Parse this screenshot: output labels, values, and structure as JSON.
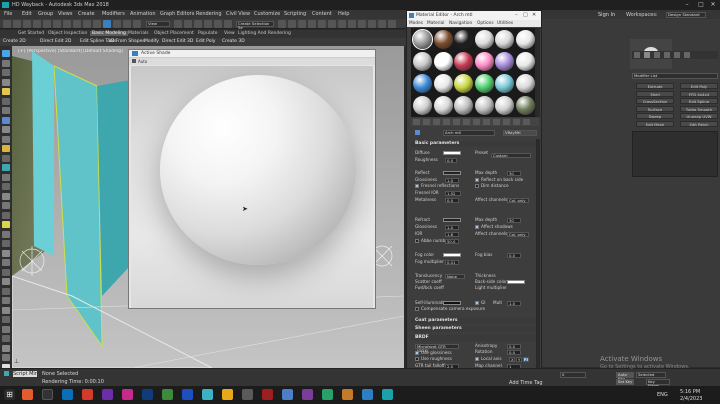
{
  "window": {
    "title": "HD Wayback - Autodesk 3ds Max 2018"
  },
  "menubar": {
    "items": [
      "File",
      "Edit",
      "Group",
      "Views",
      "Create",
      "Modifiers",
      "Animation",
      "Graph Editors",
      "Rendering",
      "Civil View",
      "Customize",
      "Scripting",
      "Content",
      "Help"
    ],
    "sign_in": "Sign In",
    "workspaces_label": "Workspaces:",
    "workspace_value": "Design Standard"
  },
  "toolbar": {
    "view_dropdown": "View",
    "selection_set": "Create Selection Se"
  },
  "ribbon": {
    "tabs": [
      "Get Started",
      "Object Inspection",
      "Basic Modeling",
      "Materials",
      "Object Placement",
      "Populate",
      "View",
      "Lighting And Rendering"
    ],
    "selected_tab": "Basic Modeling",
    "subtabs": [
      "Create 2D",
      "Direct Edit 2D",
      "Edit Spline Tools",
      "3D From Shapes",
      "Modify",
      "Direct Edit 3D",
      "Edit Poly",
      "Create 3D"
    ]
  },
  "viewport": {
    "label": "[+] [Perspective] [Standard] [Default Shading]"
  },
  "active_shade": {
    "title": "Active Shade",
    "toolbar_label": "Auto"
  },
  "material_editor": {
    "title": "Material Editor - Arch mtl",
    "menu": [
      "Modes",
      "Material",
      "Navigation",
      "Options",
      "Utilities"
    ],
    "material_name": "Arch mtl",
    "material_type": "VRayMtl",
    "sections": {
      "basic": "Basic parameters",
      "coat": "Coat parameters",
      "sheen": "Sheen parameters",
      "brdf": "BRDF",
      "options": "Options"
    },
    "basic_params": {
      "diffuse": "Diffuse",
      "roughness": "Roughness",
      "roughness_val": "0.0",
      "preset": "Preset",
      "preset_val": "Custom",
      "reflect": "Reflect",
      "max_depth": "Max depth",
      "max_depth_val": "30",
      "glossiness": "Glossiness",
      "glossiness_val": "1.0",
      "reflect_back": "Reflect on back side",
      "fresnel": "Fresnel reflections",
      "dim_distance": "Dim distance",
      "fresnel_ior": "Fresnel IOR",
      "fresnel_ior_val": "1.52",
      "metalness": "Metalness",
      "metalness_val": "0.0",
      "affect_channels": "Affect channels",
      "affect_channels_val": "Col. only",
      "refract": "Refract",
      "refract_max_depth": "Max depth",
      "refract_max_depth_val": "30",
      "refract_gloss": "Glossiness",
      "refract_gloss_val": "1.0",
      "affect_shadows": "Affect shadows",
      "ior": "IOR",
      "ior_val": "1.6",
      "refract_affect": "Affect channels",
      "refract_affect_val": "Col. only",
      "abbe": "Abbe number",
      "abbe_val": "50.0",
      "fog_color": "Fog color",
      "fog_bias": "Fog bias",
      "fog_bias_val": "0.0",
      "fog_mult": "Fog multiplier",
      "fog_mult_val": "0.01",
      "translucency": "Translucency",
      "translucency_val": "None",
      "thickness": "Thickness",
      "scatter_coeff": "Scatter coeff",
      "back_side_color": "Back-side color",
      "fwd_bck_coeff": "Fwd/bck coeff",
      "light_multiplier": "Light multiplier",
      "self_illumination": "Self-illumination",
      "gi": "GI",
      "mult": "Mult",
      "mult_val": "1.0",
      "compensate": "Compensate camera exposure"
    },
    "brdf_params": {
      "type": "Microfacet GTR (GGX)",
      "anisotropy": "Anisotropy",
      "anisotropy_val": "0.0",
      "rotation": "Rotation",
      "rotation_val": "0.0",
      "use_glossiness": "Use glossiness",
      "use_roughness": "Use roughness",
      "local_axis": "Local axis",
      "gtr_tail": "GTR tail falloff",
      "gtr_tail_val": "2.0",
      "map_channel": "Map channel",
      "map_channel_val": "1",
      "axes": [
        "X",
        "Y",
        "Z"
      ]
    }
  },
  "command_panel": {
    "modifier_list": "Modifier List",
    "buttons": [
      "Extrude",
      "Edit Poly",
      "Shell",
      "FFD 4x4x4",
      "CrossSection",
      "Edit Spline",
      "Surface",
      "Turbo Smooth",
      "Sweep",
      "Unwrap UVW",
      "Edit Mesh",
      "Edit Patch"
    ]
  },
  "status": {
    "selection": "None Selected",
    "render_time": "Rendering Time: 0:00:10",
    "script_label": "Script Mini",
    "add_time_tag": "Add Time Tag",
    "auto_key": "Auto Key",
    "set_key": "Set Key",
    "selected": "Selected",
    "key_filters": "Key Filters...",
    "frame": "0",
    "frame_total": "100"
  },
  "activation": {
    "title": "Activate Windows",
    "subtitle": "Go to Settings to activate Windows."
  },
  "taskbar": {
    "time": "5:16 PM",
    "date": "2/4/2023",
    "lang": "ENG"
  }
}
